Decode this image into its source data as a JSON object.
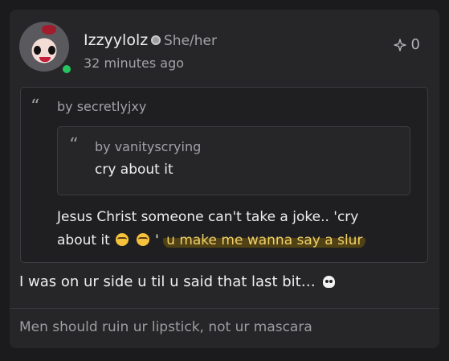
{
  "post": {
    "author": {
      "username": "Izzyylolz",
      "pronouns": "She/her",
      "online": true,
      "avatar_icon": "avatar-icon",
      "badge_icon": "badge-icon"
    },
    "timestamp": "32 minutes ago",
    "reaction": {
      "icon": "sparkle-icon",
      "count": "0"
    },
    "quote": {
      "author_label": "by secretlyjxy",
      "nested_quote": {
        "author_label": "by vanityscrying",
        "text": "cry about it"
      },
      "text_line1": "Jesus Christ someone can't take a joke.. 'cry",
      "text_prefix": "about it",
      "text_after_emoji": "'",
      "highlight_text": "u make me wanna say a slur"
    },
    "reply_text": "I was on ur side u til u said that last bit…",
    "signature": "Men should ruin ur lipstick, not ur mascara"
  }
}
